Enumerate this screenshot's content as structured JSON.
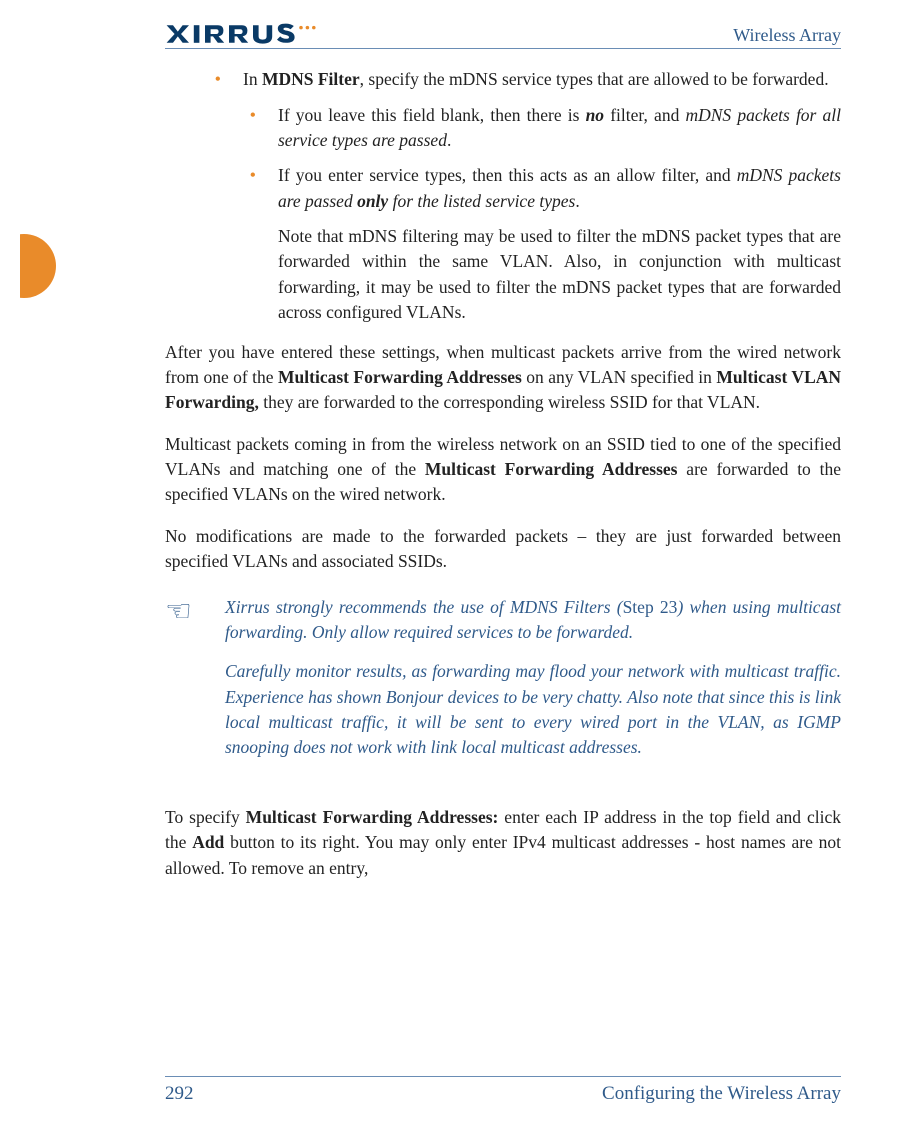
{
  "header": {
    "product": "Wireless Array"
  },
  "sections": {
    "mdns_intro_pre": "In ",
    "mdns_intro_bold": "MDNS Filter",
    "mdns_intro_post": ", specify the mDNS service types that are allowed to be forwarded.",
    "sub1_pre": "If you leave this field blank, then there is ",
    "sub1_no": "no",
    "sub1_mid": " filter, and ",
    "sub1_ital": "mDNS packets for all service types are passed",
    "sub1_post": ".",
    "sub2_pre": "If you enter service types, then this acts as an allow filter, and ",
    "sub2_ital_a": "mDNS packets are passed ",
    "sub2_only": "only",
    "sub2_ital_b": " for the listed service types",
    "sub2_post": ".",
    "mdns_note": "Note that mDNS filtering may be used to filter the mDNS packet types that are forwarded within the same VLAN. Also, in conjunction with multicast forwarding, it may be used to filter the mDNS packet types that are forwarded across configured VLANs.",
    "p_after1_a": "After you have entered these settings, when multicast packets arrive from the wired network from one of the ",
    "p_after1_b1": "Multicast Forwarding Addresses",
    "p_after1_c": " on any VLAN specified in ",
    "p_after1_b2": "Multicast VLAN Forwarding,",
    "p_after1_d": " they are forwarded to the corresponding wireless SSID for that VLAN.",
    "p_after2_a": "Multicast packets coming in from the wireless network on an SSID tied to one of the specified VLANs and matching one of the ",
    "p_after2_b": "Multicast Forwarding Addresses",
    "p_after2_c": " are forwarded to the specified VLANs on the wired network.",
    "p_after3": "No modifications are made to the forwarded packets – they are just forwarded between specified VLANs and associated SSIDs.",
    "callout1_a": "Xirrus strongly recommends the use of MDNS Filters (",
    "callout1_step": "Step 23",
    "callout1_b": ") when using multicast forwarding. Only allow required services to be forwarded.",
    "callout2": "Carefully monitor results, as forwarding may flood your network with multicast traffic. Experience has shown Bonjour devices to be very chatty. Also note that since this is link local multicast traffic, it will be sent to every wired port in the VLAN, as IGMP snooping does not work with link local multicast addresses.",
    "p_spec_a": "To specify ",
    "p_spec_b": "Multicast Forwarding Addresses:",
    "p_spec_c": " enter each IP address in the top field and click the ",
    "p_spec_d": "Add",
    "p_spec_e": " button to its right. You may only enter IPv4 multicast addresses - host names are not allowed. To remove an entry,"
  },
  "footer": {
    "page": "292",
    "section": "Configuring the Wireless Array"
  }
}
